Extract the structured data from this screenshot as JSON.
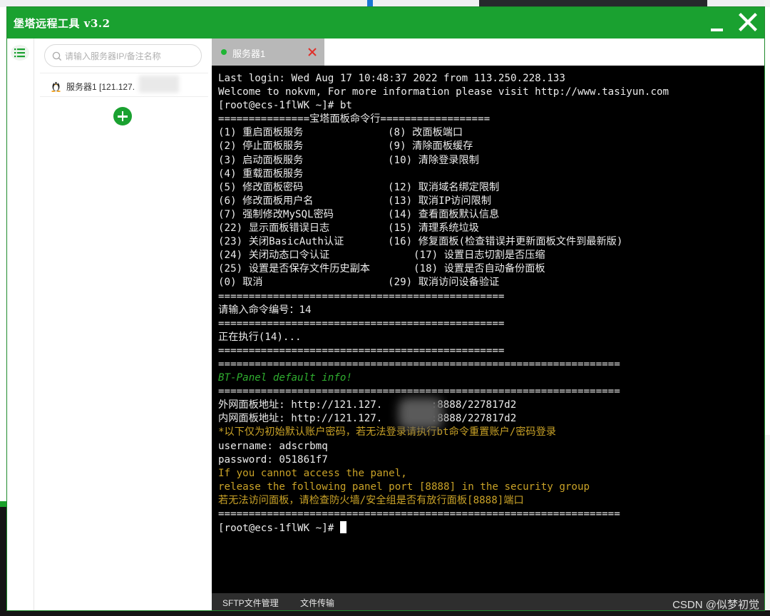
{
  "app": {
    "title": "堡塔远程工具 v3.2"
  },
  "sidebar": {
    "search_placeholder": "请输入服务器IP/备注名称",
    "servers": [
      {
        "label": "服务器1 [121.127."
      }
    ]
  },
  "tabs": [
    {
      "label": "服务器1",
      "status": "connected"
    }
  ],
  "terminal": {
    "lines": [
      {
        "text": "Last login: Wed Aug 17 10:48:37 2022 from 113.250.228.133"
      },
      {
        "text": "Welcome to nokvm, For more information please visit http://www.tasiyun.com"
      },
      {
        "text": "[root@ecs-1flWK ~]# bt"
      },
      {
        "text": "===============宝塔面板命令行=================="
      },
      {
        "left": "(1) 重启面板服务",
        "right": "(8) 改面板端口"
      },
      {
        "left": "(2) 停止面板服务",
        "right": "(9) 清除面板缓存"
      },
      {
        "left": "(3) 启动面板服务",
        "right": "(10) 清除登录限制"
      },
      {
        "left": "(4) 重载面板服务",
        "right": ""
      },
      {
        "left": "(5) 修改面板密码",
        "right": "(12) 取消域名绑定限制"
      },
      {
        "left": "(6) 修改面板用户名",
        "right": "(13) 取消IP访问限制"
      },
      {
        "left": "(7) 强制修改MySQL密码",
        "right": "(14) 查看面板默认信息"
      },
      {
        "left": "(22) 显示面板错误日志",
        "right": "(15) 清理系统垃圾"
      },
      {
        "left": "(23) 关闭BasicAuth认证",
        "right": "(16) 修复面板(检查错误并更新面板文件到最新版)"
      },
      {
        "left": "(24) 关闭动态口令认证",
        "right": "(17) 设置日志切割是否压缩",
        "shift": true
      },
      {
        "left": "(25) 设置是否保存文件历史副本",
        "right": "(18) 设置是否自动备份面板",
        "shift": true
      },
      {
        "left": "(0) 取消",
        "right": "(29) 取消访问设备验证"
      },
      {
        "text": "==============================================="
      },
      {
        "text": "请输入命令编号：14"
      },
      {
        "text": "==============================================="
      },
      {
        "text": "正在执行(14)..."
      },
      {
        "text": "==============================================="
      },
      {
        "text": "=================================================================="
      },
      {
        "text": "BT-Panel default info!",
        "color": "green"
      },
      {
        "text": "=================================================================="
      },
      {
        "text": "外网面板地址: http://121.127.        :8888/227817d2"
      },
      {
        "text": "内网面板地址: http://121.127.        :8888/227817d2"
      },
      {
        "text": "*以下仅为初始默认账户密码，若无法登录请执行bt命令重置账户/密码登录",
        "color": "yellow"
      },
      {
        "text": "username: adscrbmq"
      },
      {
        "text": "password: 051861f7"
      },
      {
        "text": "If you cannot access the panel,",
        "color": "yellow"
      },
      {
        "text": "release the following panel port [8888] in the security group",
        "color": "yellow"
      },
      {
        "text": "若无法访问面板，请检查防火墙/安全组是否有放行面板[8888]端口",
        "color": "yellow"
      },
      {
        "text": "=================================================================="
      },
      {
        "text": "[root@ecs-1flWK ~]# ",
        "cursor": true
      }
    ]
  },
  "bottom_bar": {
    "sftp_label": "SFTP文件管理",
    "transfer_label": "文件传输",
    "watermark": "CSDN @似梦初觉"
  },
  "colors": {
    "brand": "#1aa130",
    "tab_bg": "#b8b8b8",
    "terminal_bg": "#000000",
    "terminal_green": "#2fae2f",
    "terminal_yellow": "#c9a227",
    "close_red": "#e0302a"
  },
  "icons": {
    "minimize": "minimize-icon",
    "close": "close-icon",
    "list": "list-icon",
    "search": "search-icon",
    "server": "linux-tux-icon",
    "add": "add-icon",
    "tab_close": "tab-close-icon"
  }
}
